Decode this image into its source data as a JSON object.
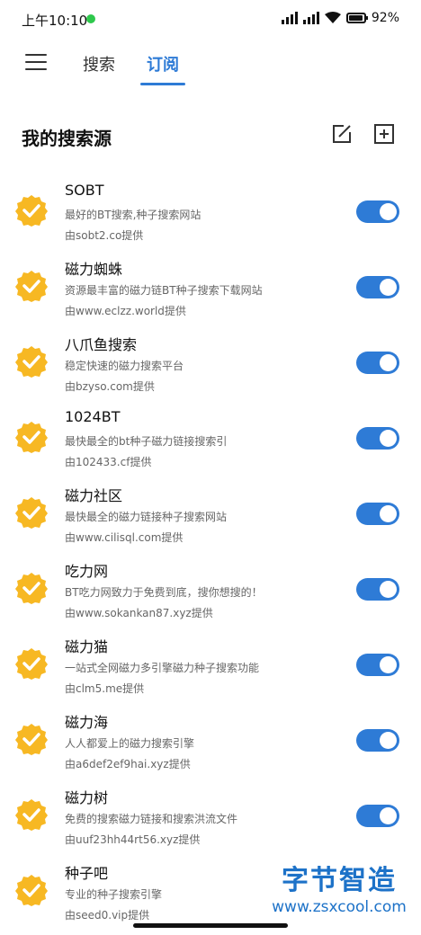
{
  "status_bar": {
    "time": "上午10:10",
    "battery": "92%",
    "battery_level": 0.92,
    "accent_dot_color": "#2ec84c"
  },
  "tabs": {
    "menu_icon": "menu-icon",
    "items": [
      {
        "label": "搜索",
        "active": false
      },
      {
        "label": "订阅",
        "active": true
      }
    ],
    "active_color": "#2e7bd6"
  },
  "section": {
    "title": "我的搜索源",
    "edit_icon": "edit-icon",
    "add_icon": "add-icon"
  },
  "sources": [
    {
      "name": "SOBT",
      "desc": "最好的BT搜索,种子搜索网站",
      "provider": "由sobt2.co提供",
      "enabled": true
    },
    {
      "name": "磁力蜘蛛",
      "desc": "资源最丰富的磁力链BT种子搜索下载网站",
      "provider": "由www.eclzz.world提供",
      "enabled": true
    },
    {
      "name": "八爪鱼搜索",
      "desc": "稳定快速的磁力搜索平台",
      "provider": "由bzyso.com提供",
      "enabled": true
    },
    {
      "name": "1024BT",
      "desc": "最快最全的bt种子磁力链接搜索引",
      "provider": "由102433.cf提供",
      "enabled": true
    },
    {
      "name": "磁力社区",
      "desc": "最快最全的磁力链接种子搜索网站",
      "provider": "由www.cilisql.com提供",
      "enabled": true
    },
    {
      "name": "吃力网",
      "desc": "BT吃力网致力于免费到底，搜你想搜的！",
      "provider": "由www.sokankan87.xyz提供",
      "enabled": true
    },
    {
      "name": "磁力猫",
      "desc": "一站式全网磁力多引擎磁力种子搜索功能",
      "provider": "由clm5.me提供",
      "enabled": true
    },
    {
      "name": "磁力海",
      "desc": "人人都爱上的磁力搜索引擎",
      "provider": "由a6def2ef9hai.xyz提供",
      "enabled": true
    },
    {
      "name": "磁力树",
      "desc": "免费的搜索磁力链接和搜索洪流文件",
      "provider": "由uuf23hh44rt56.xyz提供",
      "enabled": true
    },
    {
      "name": "种子吧",
      "desc": "专业的种子搜索引擎",
      "provider": "由seed0.vip提供",
      "enabled": false
    }
  ],
  "colors": {
    "check_badge": "#f7b823",
    "toggle_on": "#2e7bd6"
  },
  "watermark": {
    "brand": "字节智造",
    "url": "www.zsxcool.com"
  }
}
